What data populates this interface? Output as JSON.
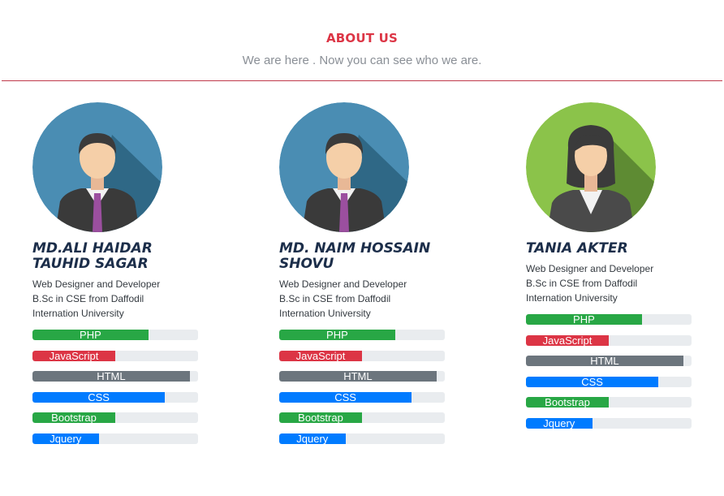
{
  "header": {
    "title": "ABOUT US",
    "subtitle": "We are here . Now you can see who we are."
  },
  "colors": {
    "accent": "#dc3545",
    "green": "#28a745",
    "red": "#dc3545",
    "gray": "#6c757d",
    "blue": "#007bff",
    "track": "#e9ecef"
  },
  "members": [
    {
      "avatar_icon": "male-avatar-icon",
      "avatar_color": "#3f7fa3",
      "name": "MD.ALI HAIDAR TAUHID SAGAR",
      "desc_line1": "Web Designer and Developer",
      "desc_line2": "B.Sc in CSE from Daffodil",
      "desc_line3": "Internation University",
      "skills": [
        {
          "label": "PHP",
          "percent": 70,
          "color": "green"
        },
        {
          "label": "JavaScript",
          "percent": 50,
          "color": "red"
        },
        {
          "label": "HTML",
          "percent": 95,
          "color": "gray"
        },
        {
          "label": "CSS",
          "percent": 80,
          "color": "blue"
        },
        {
          "label": "Bootstrap",
          "percent": 50,
          "color": "green"
        },
        {
          "label": "Jquery",
          "percent": 40,
          "color": "blue"
        }
      ]
    },
    {
      "avatar_icon": "male-avatar-icon",
      "avatar_color": "#3f7fa3",
      "name": "MD. NAIM HOSSAIN SHOVU",
      "desc_line1": "Web Designer and Developer",
      "desc_line2": "B.Sc in CSE from Daffodil",
      "desc_line3": "Internation University",
      "skills": [
        {
          "label": "PHP",
          "percent": 70,
          "color": "green"
        },
        {
          "label": "JavaScript",
          "percent": 50,
          "color": "red"
        },
        {
          "label": "HTML",
          "percent": 95,
          "color": "gray"
        },
        {
          "label": "CSS",
          "percent": 80,
          "color": "blue"
        },
        {
          "label": "Bootstrap",
          "percent": 50,
          "color": "green"
        },
        {
          "label": "Jquery",
          "percent": 40,
          "color": "blue"
        }
      ]
    },
    {
      "avatar_icon": "female-avatar-icon",
      "avatar_color": "#7cb342",
      "name": "TANIA AKTER",
      "desc_line1": "Web Designer and Developer",
      "desc_line2": "B.Sc in CSE from Daffodil",
      "desc_line3": "Internation University",
      "skills": [
        {
          "label": "PHP",
          "percent": 70,
          "color": "green"
        },
        {
          "label": "JavaScript",
          "percent": 50,
          "color": "red"
        },
        {
          "label": "HTML",
          "percent": 95,
          "color": "gray"
        },
        {
          "label": "CSS",
          "percent": 80,
          "color": "blue"
        },
        {
          "label": "Bootstrap",
          "percent": 50,
          "color": "green"
        },
        {
          "label": "Jquery",
          "percent": 40,
          "color": "blue"
        }
      ]
    }
  ]
}
